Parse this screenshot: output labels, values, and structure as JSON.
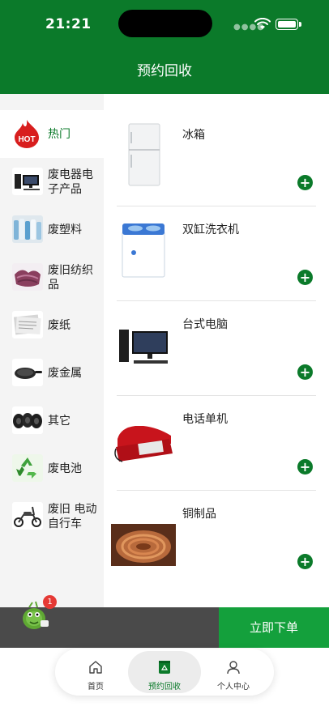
{
  "status": {
    "time": "21:21"
  },
  "header": {
    "title": "预约回收"
  },
  "sidebar": {
    "items": [
      {
        "label": "热门",
        "icon": "hot-icon",
        "active": true
      },
      {
        "label": "废电器电子产品",
        "icon": "computer-thumbnail"
      },
      {
        "label": "废塑料",
        "icon": "plastic-bottles-thumbnail"
      },
      {
        "label": "废旧纺织品",
        "icon": "textiles-thumbnail"
      },
      {
        "label": "废纸",
        "icon": "paper-thumbnail"
      },
      {
        "label": "废金属",
        "icon": "pan-thumbnail"
      },
      {
        "label": "其它",
        "icon": "tires-thumbnail"
      },
      {
        "label": "废电池",
        "icon": "recycle-thumbnail"
      },
      {
        "label": "废旧 电动自行车",
        "icon": "scooter-thumbnail"
      }
    ]
  },
  "products": [
    {
      "name": "冰箱",
      "icon": "fridge-image"
    },
    {
      "name": "双缸洗衣机",
      "icon": "washing-machine-image"
    },
    {
      "name": "台式电脑",
      "icon": "desktop-computer-image"
    },
    {
      "name": "电话单机",
      "icon": "telephone-image"
    },
    {
      "name": "铜制品",
      "icon": "copper-wire-image"
    }
  ],
  "cart": {
    "badge": "1"
  },
  "order_button": {
    "label": "立即下单"
  },
  "tabbar": {
    "tabs": [
      {
        "label": "首页",
        "icon": "home-icon"
      },
      {
        "label": "预约回收",
        "icon": "recycle-bin-icon",
        "active": true
      },
      {
        "label": "个人中心",
        "icon": "user-icon"
      }
    ]
  },
  "colors": {
    "brand_green": "#0b7a2a",
    "button_green": "#14a03c",
    "badge_red": "#e53935"
  }
}
